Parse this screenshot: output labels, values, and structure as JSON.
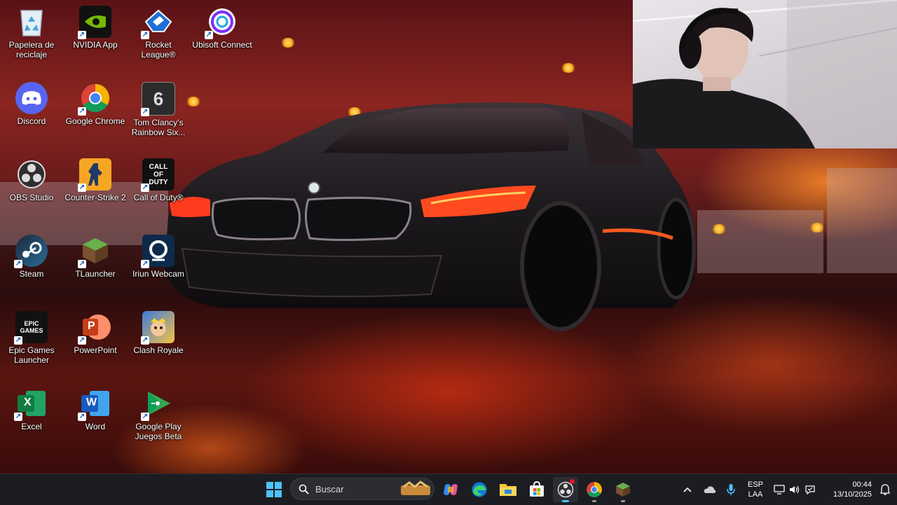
{
  "desktop": {
    "icons": [
      {
        "label": "Papelera de reciclaje",
        "icon": "recycle-bin-icon"
      },
      {
        "label": "NVIDIA App",
        "icon": "nvidia-icon"
      },
      {
        "label": "Rocket League®",
        "icon": "rocket-league-icon"
      },
      {
        "label": "Ubisoft Connect",
        "icon": "ubisoft-icon"
      },
      {
        "label": "Discord",
        "icon": "discord-icon"
      },
      {
        "label": "Google Chrome",
        "icon": "chrome-icon"
      },
      {
        "label": "Tom Clancy's Rainbow Six...",
        "icon": "rainbow-six-icon"
      },
      {
        "label": "OBS Studio",
        "icon": "obs-icon"
      },
      {
        "label": "Counter-Strike 2",
        "icon": "counter-strike-icon"
      },
      {
        "label": "Call of Duty®",
        "icon": "call-of-duty-icon"
      },
      {
        "label": "Steam",
        "icon": "steam-icon"
      },
      {
        "label": "TLauncher",
        "icon": "tlauncher-icon"
      },
      {
        "label": "Iriun Webcam",
        "icon": "iriun-webcam-icon"
      },
      {
        "label": "Epic Games Launcher",
        "icon": "epic-games-icon"
      },
      {
        "label": "PowerPoint",
        "icon": "powerpoint-icon"
      },
      {
        "label": "Clash Royale",
        "icon": "clash-royale-icon"
      },
      {
        "label": "Excel",
        "icon": "excel-icon"
      },
      {
        "label": "Word",
        "icon": "word-icon"
      },
      {
        "label": "Google Play Juegos Beta",
        "icon": "google-play-games-icon"
      }
    ],
    "rainbow_logo_text": "6",
    "cod_logo_text": "CALL OF DUTY",
    "epic_logo_text": "EPIC GAMES",
    "excel_letter": "X",
    "word_letter": "W",
    "ppt_letter": "P"
  },
  "taskbar": {
    "search_placeholder": "Buscar",
    "pinned": [
      "start-button",
      "copilot-icon",
      "edge-icon",
      "file-explorer-icon",
      "microsoft-store-icon",
      "obs-taskbar-icon",
      "chrome-taskbar-icon",
      "minecraft-taskbar-icon"
    ],
    "tray": {
      "language_line1": "ESP",
      "language_line2": "LAA",
      "time": "00:44",
      "date": "13/10/2025"
    }
  },
  "colors": {
    "taskbar_bg": "#1c1d22",
    "active_indicator": "#4cc2ff",
    "notification_dot": "#e81123"
  }
}
